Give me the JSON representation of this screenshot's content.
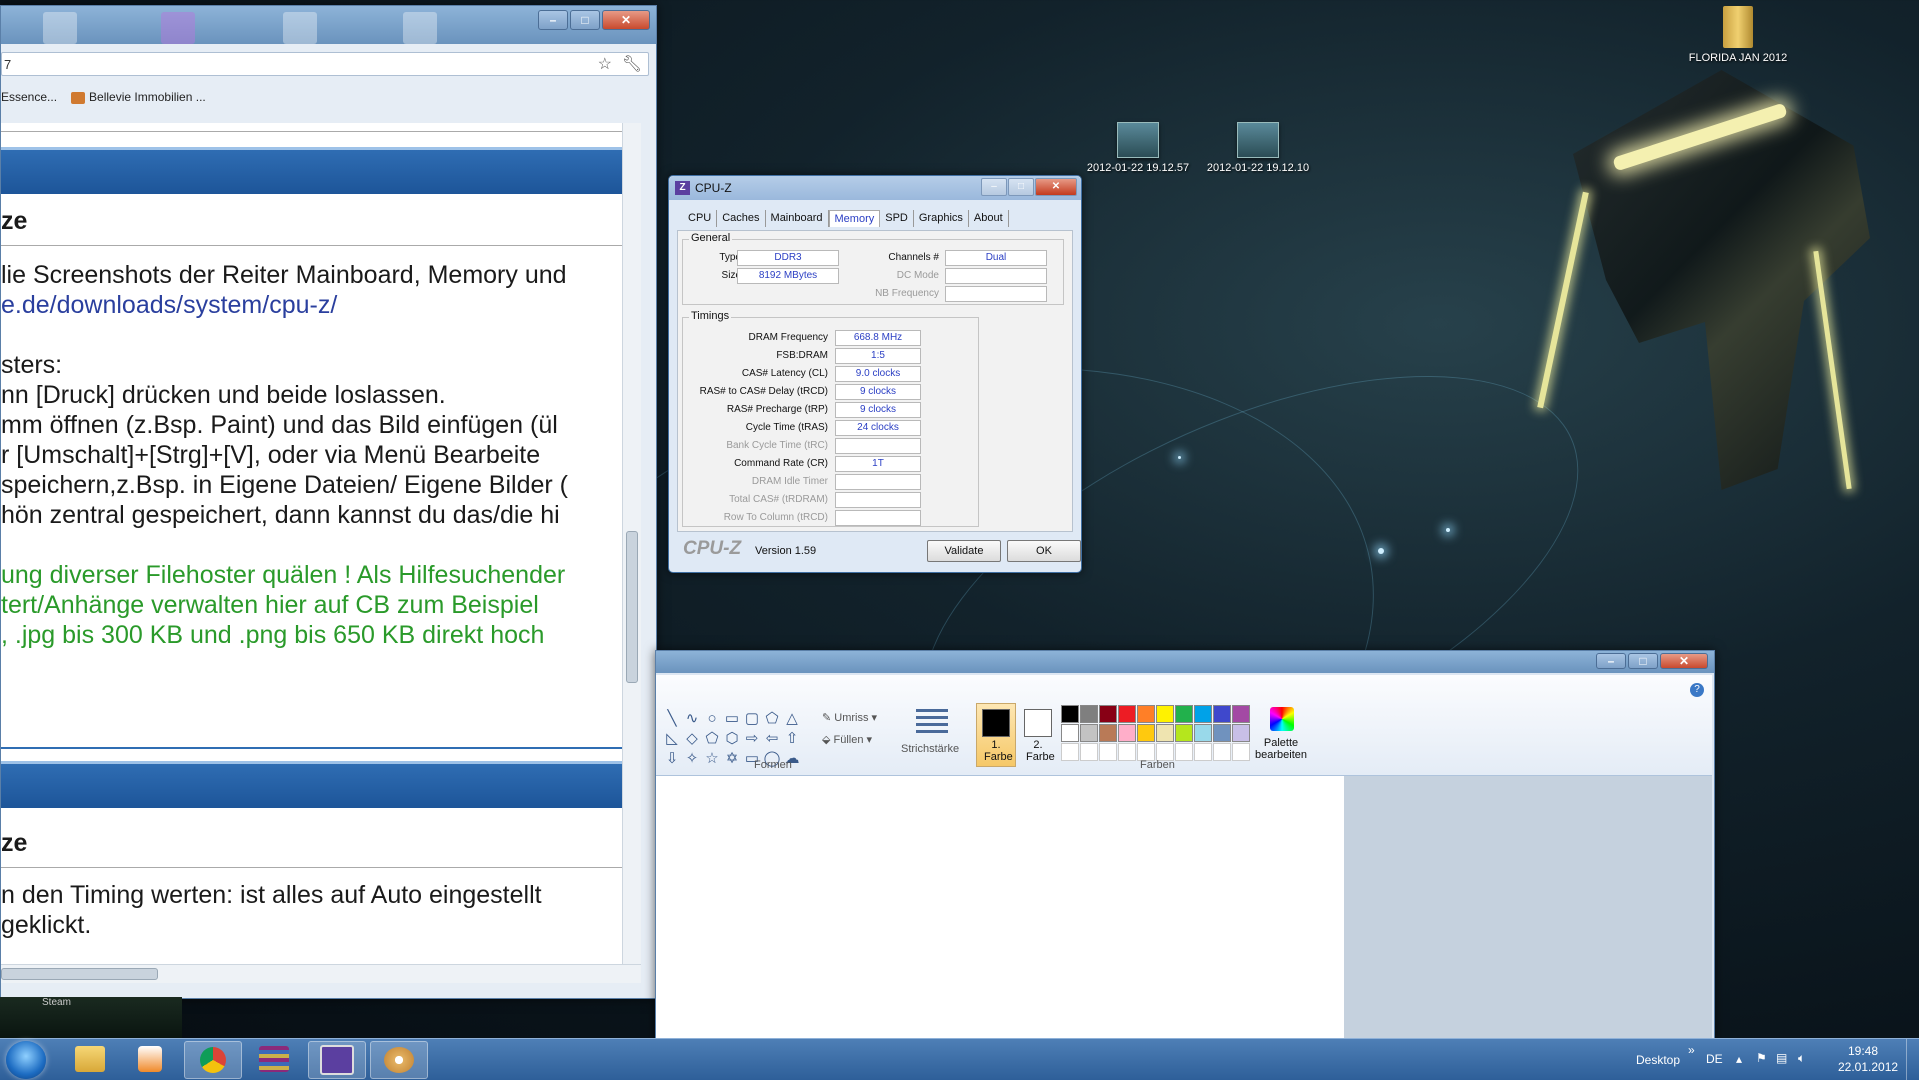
{
  "desktop": {
    "icons": [
      {
        "label": "FLORIDA JAN 2012",
        "type": "folder"
      },
      {
        "label": "2012-01-22 19.12.57",
        "type": "image"
      },
      {
        "label": "2012-01-22 19.12.10",
        "type": "image"
      }
    ]
  },
  "browser": {
    "address": "7",
    "bookmarks": [
      "Essence...",
      "Bellevie Immobilien ..."
    ],
    "post1": {
      "heading": "ze",
      "lines": [
        "lie Screenshots der Reiter Mainboard, Memory und",
        "e.de/downloads/system/cpu-z/",
        "sters:",
        "nn [Druck] drücken und beide loslassen.",
        "mm öffnen (z.Bsp. Paint) und das Bild einfügen (ül",
        "r [Umschalt]+[Strg]+[V], oder via Menü Bearbeite",
        "speichern,z.Bsp. in Eigene Dateien/ Eigene Bilder (",
        "hön zentral gespeichert, dann kannst du das/die hi"
      ],
      "green_lines": [
        "ung diverser Filehoster quälen ! Als Hilfesuchender",
        "tert/Anhänge verwalten hier auf CB zum Beispiel",
        ", .jpg bis 300 KB und .png bis 650 KB direkt hoch"
      ]
    },
    "post2": {
      "heading": "ze",
      "lines": [
        "n den Timing werten: ist alles auf Auto eingestellt",
        "geklickt."
      ]
    }
  },
  "cpuz": {
    "title": "CPU-Z",
    "tabs": [
      "CPU",
      "Caches",
      "Mainboard",
      "Memory",
      "SPD",
      "Graphics",
      "About"
    ],
    "active_tab": "Memory",
    "general": {
      "legend": "General",
      "type_label": "Type",
      "type_value": "DDR3",
      "size_label": "Size",
      "size_value": "8192 MBytes",
      "channels_label": "Channels #",
      "channels_value": "Dual",
      "dcmode_label": "DC Mode",
      "nbfreq_label": "NB Frequency"
    },
    "timings": {
      "legend": "Timings",
      "rows": [
        {
          "label": "DRAM Frequency",
          "value": "668.8 MHz",
          "dim": false
        },
        {
          "label": "FSB:DRAM",
          "value": "1:5",
          "dim": false
        },
        {
          "label": "CAS# Latency (CL)",
          "value": "9.0 clocks",
          "dim": false
        },
        {
          "label": "RAS# to CAS# Delay (tRCD)",
          "value": "9 clocks",
          "dim": false
        },
        {
          "label": "RAS# Precharge (tRP)",
          "value": "9 clocks",
          "dim": false
        },
        {
          "label": "Cycle Time (tRAS)",
          "value": "24 clocks",
          "dim": false
        },
        {
          "label": "Bank Cycle Time (tRC)",
          "value": "",
          "dim": true
        },
        {
          "label": "Command Rate (CR)",
          "value": "1T",
          "dim": false
        },
        {
          "label": "DRAM Idle Timer",
          "value": "",
          "dim": true
        },
        {
          "label": "Total CAS# (tRDRAM)",
          "value": "",
          "dim": true
        },
        {
          "label": "Row To Column (tRCD)",
          "value": "",
          "dim": true
        }
      ]
    },
    "brand": "CPU-Z",
    "version": "Version 1.59",
    "validate_label": "Validate",
    "ok_label": "OK"
  },
  "paint": {
    "outline_label": "Umriss",
    "fill_label": "Füllen",
    "stroke_label": "Strichstärke",
    "color1_label": "1. Farbe",
    "color2_label": "2. Farbe",
    "edit_palette_label": "Palette bearbeiten",
    "shapes_group": "Formen",
    "colors_group": "Farben",
    "color1": "#000000",
    "color2": "#ffffff",
    "palette_row1": [
      "#000000",
      "#7f7f7f",
      "#880015",
      "#ed1c24",
      "#ff7f27",
      "#fff200",
      "#22b14c",
      "#00a2e8",
      "#3f48cc",
      "#a349a4"
    ],
    "palette_row2": [
      "#ffffff",
      "#c3c3c3",
      "#b97a57",
      "#ffaec9",
      "#ffc90e",
      "#efe4b0",
      "#b5e61d",
      "#99d9ea",
      "#7092be",
      "#c8bfe7"
    ]
  },
  "taskbar": {
    "desktop_label": "Desktop",
    "language": "DE",
    "time": "19:48",
    "date": "22.01.2012",
    "strip_label": "Steam"
  }
}
